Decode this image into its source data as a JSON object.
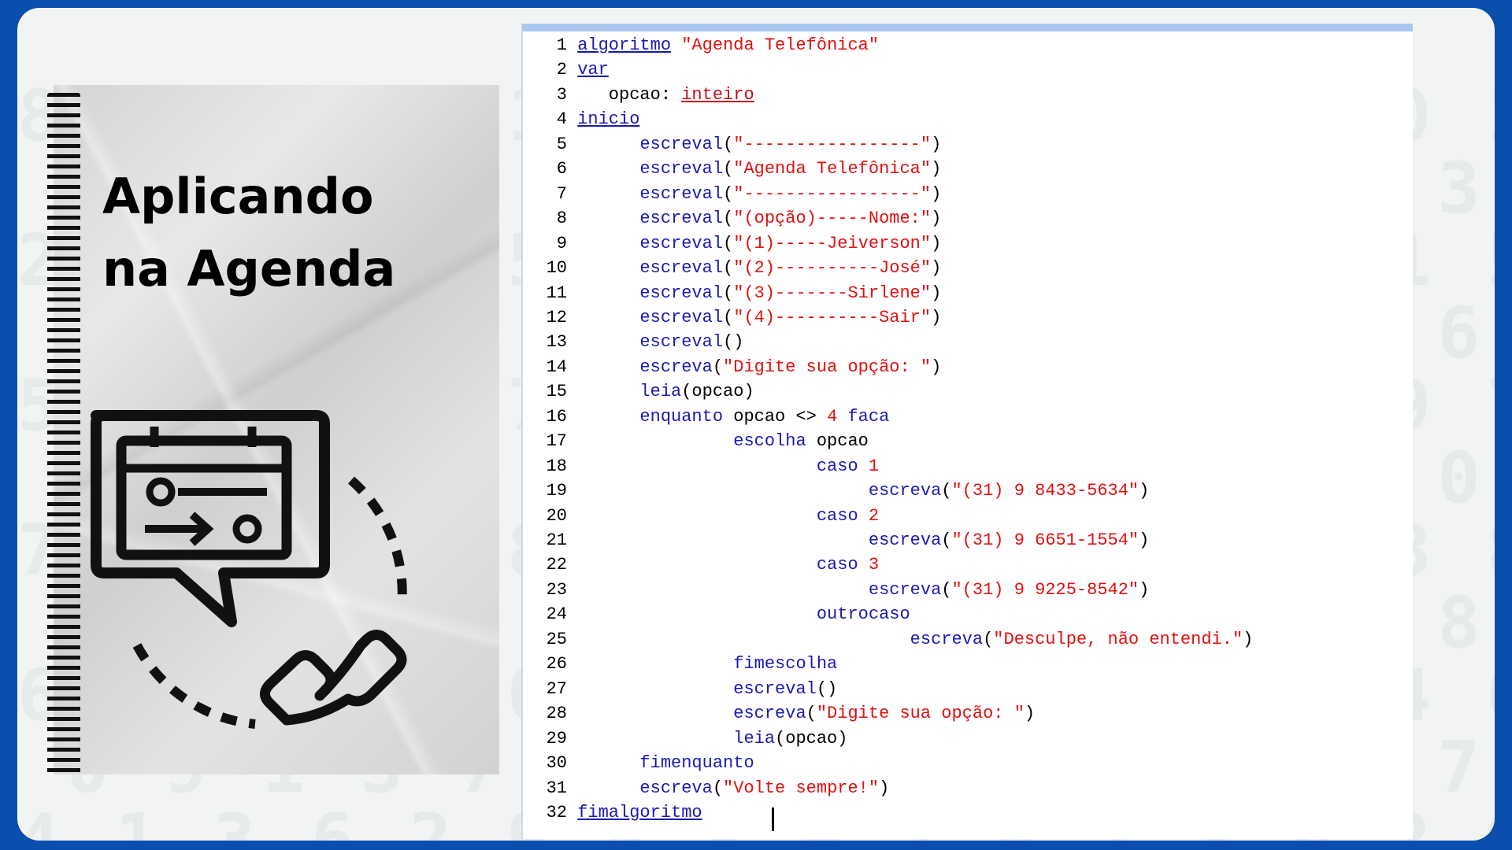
{
  "title": {
    "line1": "Aplicando",
    "line2": "na Agenda"
  },
  "icons": {
    "main": "phone-agenda-icon"
  },
  "colors": {
    "frame": "#0b4fae",
    "keyword": "#1a1ab0",
    "string": "#e01010"
  },
  "code": [
    {
      "n": "1",
      "tokens": [
        {
          "t": "algoritmo",
          "c": "kw-u"
        },
        {
          "t": " ",
          "c": "plain"
        },
        {
          "t": "\"Agenda Telefônica\"",
          "c": "str"
        }
      ]
    },
    {
      "n": "2",
      "tokens": [
        {
          "t": "var",
          "c": "kw-u"
        }
      ]
    },
    {
      "n": "3",
      "tokens": [
        {
          "t": "   opcao: ",
          "c": "plain"
        },
        {
          "t": "inteiro",
          "c": "type"
        }
      ]
    },
    {
      "n": "4",
      "tokens": [
        {
          "t": "inicio",
          "c": "kw-u"
        }
      ]
    },
    {
      "n": "5",
      "tokens": [
        {
          "t": "      escreval",
          "c": "kw"
        },
        {
          "t": "(",
          "c": "plain"
        },
        {
          "t": "\"-----------------\"",
          "c": "str"
        },
        {
          "t": ")",
          "c": "plain"
        }
      ]
    },
    {
      "n": "6",
      "tokens": [
        {
          "t": "      escreval",
          "c": "kw"
        },
        {
          "t": "(",
          "c": "plain"
        },
        {
          "t": "\"Agenda Telefônica\"",
          "c": "str"
        },
        {
          "t": ")",
          "c": "plain"
        }
      ]
    },
    {
      "n": "7",
      "tokens": [
        {
          "t": "      escreval",
          "c": "kw"
        },
        {
          "t": "(",
          "c": "plain"
        },
        {
          "t": "\"-----------------\"",
          "c": "str"
        },
        {
          "t": ")",
          "c": "plain"
        }
      ]
    },
    {
      "n": "8",
      "tokens": [
        {
          "t": "      escreval",
          "c": "kw"
        },
        {
          "t": "(",
          "c": "plain"
        },
        {
          "t": "\"(opção)-----Nome:\"",
          "c": "str"
        },
        {
          "t": ")",
          "c": "plain"
        }
      ]
    },
    {
      "n": "9",
      "tokens": [
        {
          "t": "      escreval",
          "c": "kw"
        },
        {
          "t": "(",
          "c": "plain"
        },
        {
          "t": "\"(1)-----Jeiverson\"",
          "c": "str"
        },
        {
          "t": ")",
          "c": "plain"
        }
      ]
    },
    {
      "n": "10",
      "tokens": [
        {
          "t": "      escreval",
          "c": "kw"
        },
        {
          "t": "(",
          "c": "plain"
        },
        {
          "t": "\"(2)----------José\"",
          "c": "str"
        },
        {
          "t": ")",
          "c": "plain"
        }
      ]
    },
    {
      "n": "11",
      "tokens": [
        {
          "t": "      escreval",
          "c": "kw"
        },
        {
          "t": "(",
          "c": "plain"
        },
        {
          "t": "\"(3)-------Sirlene\"",
          "c": "str"
        },
        {
          "t": ")",
          "c": "plain"
        }
      ]
    },
    {
      "n": "12",
      "tokens": [
        {
          "t": "      escreval",
          "c": "kw"
        },
        {
          "t": "(",
          "c": "plain"
        },
        {
          "t": "\"(4)----------Sair\"",
          "c": "str"
        },
        {
          "t": ")",
          "c": "plain"
        }
      ]
    },
    {
      "n": "13",
      "tokens": [
        {
          "t": "      escreval",
          "c": "kw"
        },
        {
          "t": "()",
          "c": "plain"
        }
      ]
    },
    {
      "n": "14",
      "tokens": [
        {
          "t": "      escreva",
          "c": "kw"
        },
        {
          "t": "(",
          "c": "plain"
        },
        {
          "t": "\"Digite sua opção: \"",
          "c": "str"
        },
        {
          "t": ")",
          "c": "plain"
        }
      ]
    },
    {
      "n": "15",
      "tokens": [
        {
          "t": "      leia",
          "c": "kw"
        },
        {
          "t": "(opcao)",
          "c": "plain"
        }
      ]
    },
    {
      "n": "16",
      "tokens": [
        {
          "t": "      enquanto",
          "c": "kw"
        },
        {
          "t": " opcao <> ",
          "c": "plain"
        },
        {
          "t": "4",
          "c": "num"
        },
        {
          "t": " faca",
          "c": "kw"
        }
      ]
    },
    {
      "n": "17",
      "tokens": [
        {
          "t": "               escolha",
          "c": "kw"
        },
        {
          "t": " opcao",
          "c": "plain"
        }
      ]
    },
    {
      "n": "18",
      "tokens": [
        {
          "t": "                       caso",
          "c": "kw"
        },
        {
          "t": " 1",
          "c": "num"
        }
      ]
    },
    {
      "n": "19",
      "tokens": [
        {
          "t": "                            escreva",
          "c": "kw"
        },
        {
          "t": "(",
          "c": "plain"
        },
        {
          "t": "\"(31) 9 8433-5634\"",
          "c": "str"
        },
        {
          "t": ")",
          "c": "plain"
        }
      ]
    },
    {
      "n": "20",
      "tokens": [
        {
          "t": "                       caso",
          "c": "kw"
        },
        {
          "t": " 2",
          "c": "num"
        }
      ]
    },
    {
      "n": "21",
      "tokens": [
        {
          "t": "                            escreva",
          "c": "kw"
        },
        {
          "t": "(",
          "c": "plain"
        },
        {
          "t": "\"(31) 9 6651-1554\"",
          "c": "str"
        },
        {
          "t": ")",
          "c": "plain"
        }
      ]
    },
    {
      "n": "22",
      "tokens": [
        {
          "t": "                       caso",
          "c": "kw"
        },
        {
          "t": " 3",
          "c": "num"
        }
      ]
    },
    {
      "n": "23",
      "tokens": [
        {
          "t": "                            escreva",
          "c": "kw"
        },
        {
          "t": "(",
          "c": "plain"
        },
        {
          "t": "\"(31) 9 9225-8542\"",
          "c": "str"
        },
        {
          "t": ")",
          "c": "plain"
        }
      ]
    },
    {
      "n": "24",
      "tokens": [
        {
          "t": "                       outrocaso",
          "c": "kw"
        }
      ]
    },
    {
      "n": "25",
      "tokens": [
        {
          "t": "                                escreva",
          "c": "kw"
        },
        {
          "t": "(",
          "c": "plain"
        },
        {
          "t": "\"Desculpe, não entendi.\"",
          "c": "str"
        },
        {
          "t": ")",
          "c": "plain"
        }
      ]
    },
    {
      "n": "26",
      "tokens": [
        {
          "t": "               fimescolha",
          "c": "kw"
        }
      ]
    },
    {
      "n": "27",
      "tokens": [
        {
          "t": "               escreval",
          "c": "kw"
        },
        {
          "t": "()",
          "c": "plain"
        }
      ]
    },
    {
      "n": "28",
      "tokens": [
        {
          "t": "               escreva",
          "c": "kw"
        },
        {
          "t": "(",
          "c": "plain"
        },
        {
          "t": "\"Digite sua opção: \"",
          "c": "str"
        },
        {
          "t": ")",
          "c": "plain"
        }
      ]
    },
    {
      "n": "29",
      "tokens": [
        {
          "t": "               leia",
          "c": "kw"
        },
        {
          "t": "(opcao)",
          "c": "plain"
        }
      ]
    },
    {
      "n": "30",
      "tokens": [
        {
          "t": "      fimenquanto",
          "c": "kw"
        }
      ]
    },
    {
      "n": "31",
      "tokens": [
        {
          "t": "      escreva",
          "c": "kw"
        },
        {
          "t": "(",
          "c": "plain"
        },
        {
          "t": "\"Volte sempre!\"",
          "c": "str"
        },
        {
          "t": ")",
          "c": "plain"
        }
      ]
    },
    {
      "n": "32",
      "tokens": [
        {
          "t": "fimalgoritmo",
          "c": "kw-u"
        }
      ]
    }
  ]
}
